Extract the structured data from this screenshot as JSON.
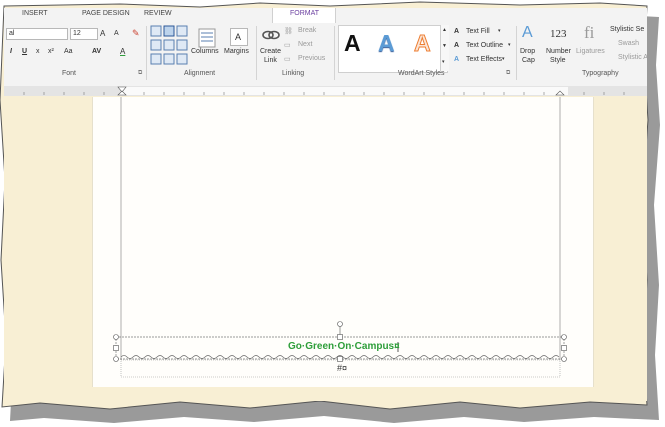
{
  "tabs": {
    "insert": "INSERT",
    "page_design": "PAGE DESIGN",
    "review": "REVIEW",
    "format": "FORMAT"
  },
  "font": {
    "name": "al",
    "size": "12",
    "grow_label": "A",
    "shrink_label": "A",
    "bold": "I",
    "underline": "U",
    "subscript": "x",
    "superscript": "x²",
    "case": "Aa",
    "spacing": "AV",
    "color_label": "A",
    "group_label": "Font"
  },
  "alignment": {
    "columns_label": "Columns",
    "margins_label": "Margins",
    "group_label": "Alignment"
  },
  "linking": {
    "create_link_label": "Create Link",
    "create_link_line1": "Create",
    "create_link_line2": "Link",
    "break_label": "Break",
    "next_label": "Next",
    "previous_label": "Previous",
    "group_label": "Linking"
  },
  "wordart_styles": {
    "style1": "A",
    "style2": "A",
    "style3": "A",
    "text_fill": "Text Fill",
    "text_outline": "Text Outline",
    "text_effects": "Text Effects",
    "group_label": "WordArt Styles"
  },
  "typography": {
    "drop_cap_line1": "Drop",
    "drop_cap_line2": "Cap",
    "number_style_glyph": "123",
    "number_style_line1": "Number",
    "number_style_line2": "Style",
    "ligatures_glyph": "fi",
    "ligatures_label": "Ligatures",
    "stylistic_sets": "Stylistic Se",
    "swash": "Swash",
    "stylistic_alternates": "Stylistic Al",
    "group_label": "Typography"
  },
  "document": {
    "wordart_text": "Go·Green·On·Campus¤",
    "paragraph_mark": "#¤"
  },
  "colors": {
    "wordart_green": "#2e9e3a",
    "format_tab": "#6b3fa0",
    "canvas": "#f8efd4",
    "wordart_blue": "#5b9bd5",
    "wordart_orange": "#f4b183"
  }
}
